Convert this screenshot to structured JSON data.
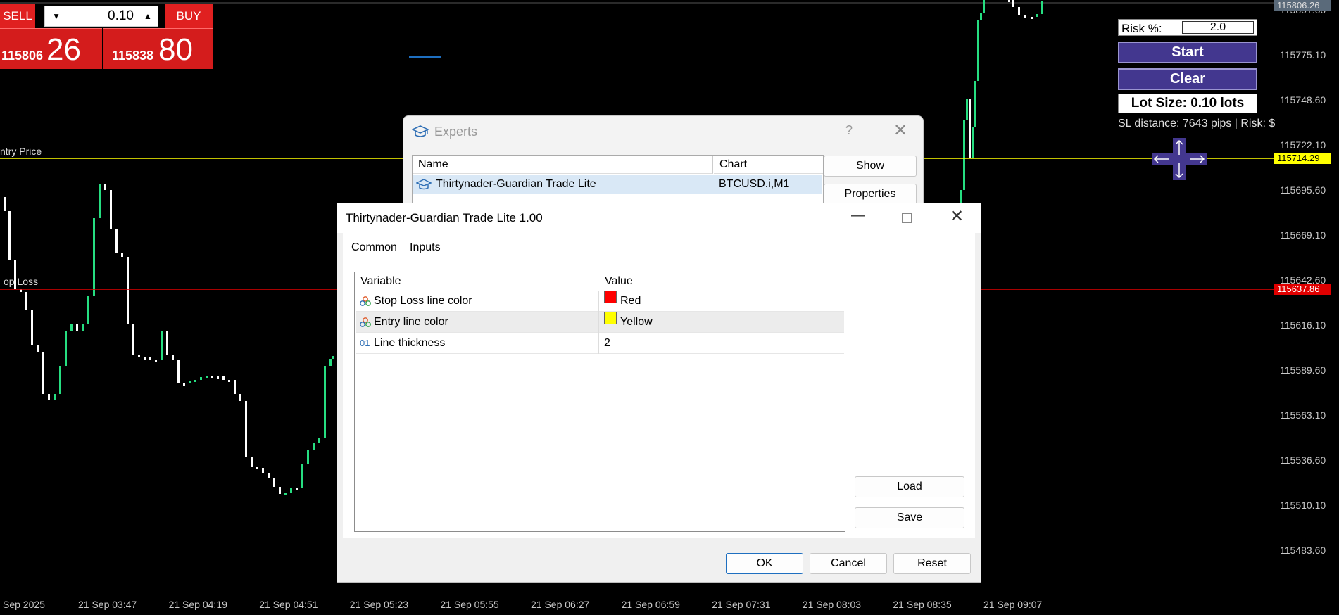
{
  "trade_panel": {
    "sell_label": "SELL",
    "buy_label": "BUY",
    "lot_value": "0.10",
    "sell_price_small": "115806",
    "sell_price_big": "26",
    "buy_price_small": "115838",
    "buy_price_big": "80"
  },
  "price_axis": {
    "labels": [
      "115801.60",
      "115775.10",
      "115748.60",
      "115722.10",
      "115695.60",
      "115669.10",
      "115642.60",
      "115616.10",
      "115589.60",
      "115563.10",
      "115536.60",
      "115510.10",
      "115483.60"
    ],
    "top_tag": "115806.26",
    "entry_tag": "115714.29",
    "stop_tag": "115637.86",
    "entry_tag_color": "#ffff00",
    "stop_tag_color": "#e00000"
  },
  "time_axis": [
    "Sep 2025",
    "21 Sep 03:47",
    "21 Sep 04:19",
    "21 Sep 04:51",
    "21 Sep 05:23",
    "21 Sep 05:55",
    "21 Sep 06:27",
    "21 Sep 06:59",
    "21 Sep 07:31",
    "21 Sep 08:03",
    "21 Sep 08:35",
    "21 Sep 09:07"
  ],
  "chart_lines": {
    "entry_label": "ntry Price",
    "stop_label": "op Loss",
    "entry_color": "#ffff00",
    "stop_color": "#e00000",
    "candle_up_color": "#26de81",
    "candle_down_color": "#ffffff"
  },
  "risk_panel": {
    "risk_label": "Risk %:",
    "risk_value": "2.0",
    "start_label": "Start",
    "clear_label": "Clear",
    "lot_size_text": "Lot Size: 0.10 lots",
    "sl_distance_text": "SL distance: 7643 pips | Risk: $",
    "arrows_icon": "four-way-arrows-icon",
    "accent": "#43378f"
  },
  "experts_window": {
    "title": "Experts",
    "help": "?",
    "columns": [
      "Name",
      "Chart"
    ],
    "rows": [
      {
        "name": "Thirtynader-Guardian Trade Lite",
        "chart": "BTCUSD.i,M1"
      }
    ],
    "show_label": "Show",
    "properties_label": "Properties"
  },
  "dialog": {
    "title": "Thirtynader-Guardian Trade Lite 1.00",
    "tabs": [
      "Common",
      "Inputs"
    ],
    "active_tab": "Inputs",
    "columns": [
      "Variable",
      "Value"
    ],
    "inputs": [
      {
        "variable": "Stop Loss line color",
        "value": "Red",
        "swatch": "#ff0000",
        "icon": "color-palette-icon"
      },
      {
        "variable": "Entry line color",
        "value": "Yellow",
        "swatch": "#ffff00",
        "icon": "color-palette-icon"
      },
      {
        "variable": "Line thickness",
        "value": "2",
        "swatch": "",
        "icon": "integer-type-icon"
      }
    ],
    "icon_glyph_int": "01",
    "load_label": "Load",
    "save_label": "Save",
    "ok_label": "OK",
    "cancel_label": "Cancel",
    "reset_label": "Reset"
  }
}
